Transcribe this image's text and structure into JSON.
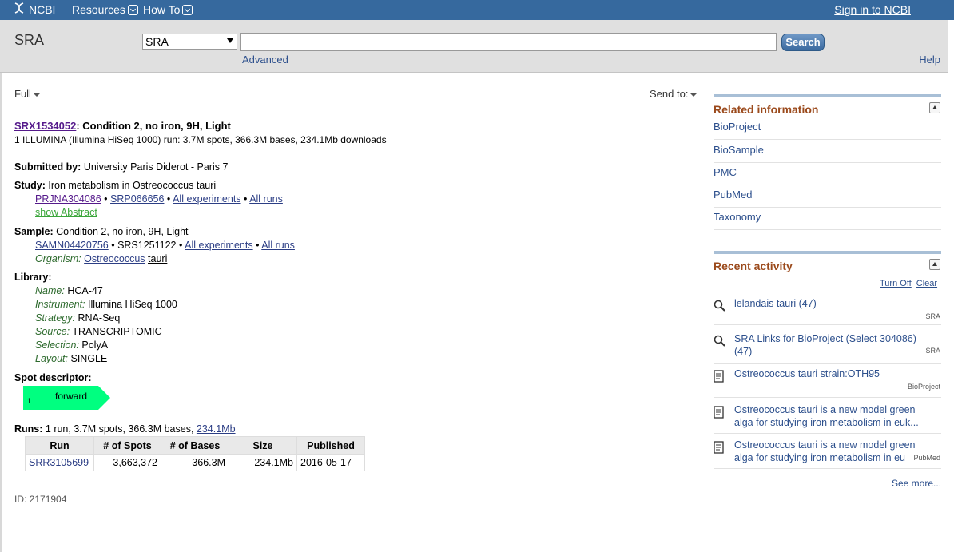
{
  "header": {
    "logo": "NCBI",
    "menus": [
      "Resources",
      "How To"
    ],
    "signin": "Sign in to NCBI"
  },
  "search": {
    "db_title": "SRA",
    "db_selected": "SRA",
    "term_value": "",
    "button": "Search",
    "advanced": "Advanced",
    "help": "Help"
  },
  "controls": {
    "format": "Full",
    "send_to": "Send to:"
  },
  "record": {
    "accession": "SRX1534052",
    "title": ": Condition 2, no iron, 9H, Light",
    "summary": "1 ILLUMINA (Illumina HiSeq 1000) run: 3.7M spots, 366.3M bases, 234.1Mb downloads",
    "submitted_label": "Submitted by:",
    "submitted_value": " University Paris Diderot - Paris 7",
    "study": {
      "label": "Study:",
      "value": " Iron metabolism in Ostreococcus tauri",
      "bioproject": "PRJNA304086",
      "srp": "SRP066656",
      "all_experiments": "All experiments",
      "all_runs": "All runs",
      "show_abstract": "show Abstract"
    },
    "sample": {
      "label": "Sample:",
      "value": " Condition 2, no iron, 9H, Light",
      "biosample": "SAMN04420756",
      "srs": "SRS1251122",
      "all_experiments": "All experiments",
      "all_runs": "All runs",
      "organism_label": "Organism:",
      "organism_genus": "Ostreococcus",
      "organism_species": "tauri"
    },
    "library": {
      "label": "Library:",
      "fields": [
        {
          "key": "Name:",
          "value": "HCA-47"
        },
        {
          "key": "Instrument:",
          "value": "Illumina HiSeq 1000"
        },
        {
          "key": "Strategy:",
          "value": "RNA-Seq"
        },
        {
          "key": "Source:",
          "value": "TRANSCRIPTOMIC"
        },
        {
          "key": "Selection:",
          "value": "PolyA"
        },
        {
          "key": "Layout:",
          "value": "SINGLE"
        }
      ]
    },
    "spot_descriptor": {
      "label": "Spot descriptor:",
      "position": "1",
      "direction": "forward",
      "color": "#00ff80"
    },
    "runs": {
      "label": "Runs:",
      "summary": " 1 run, 3.7M spots, 366.3M bases, ",
      "size_link": "234.1Mb",
      "columns": [
        "Run",
        "# of Spots",
        "# of Bases",
        "Size",
        "Published"
      ],
      "rows": [
        [
          "SRR3105699",
          "3,663,372",
          "366.3M",
          "234.1Mb",
          "2016-05-17"
        ]
      ]
    },
    "id_line": "ID: 2171904"
  },
  "sidebar": {
    "related_title": "Related information",
    "related_items": [
      "BioProject",
      "BioSample",
      "PMC",
      "PubMed",
      "Taxonomy"
    ],
    "recent_title": "Recent activity",
    "turn_off": "Turn Off",
    "clear": "Clear",
    "recent_items": [
      {
        "icon": "search-icon",
        "text": "lelandais tauri (47)",
        "source": "SRA"
      },
      {
        "icon": "search-icon",
        "text": "SRA Links for BioProject (Select 304086) (47)",
        "source": "SRA"
      },
      {
        "icon": "document-icon",
        "text": "Ostreococcus tauri strain:OTH95",
        "source": "BioProject"
      },
      {
        "icon": "document-icon",
        "text": "Ostreococcus tauri is a new model green alga for studying iron metabolism in euk...",
        "source": ""
      },
      {
        "icon": "document-icon",
        "text": "Ostreococcus tauri is a new model green alga for studying iron metabolism in eu",
        "source": "PubMed"
      }
    ],
    "see_more": "See more..."
  }
}
